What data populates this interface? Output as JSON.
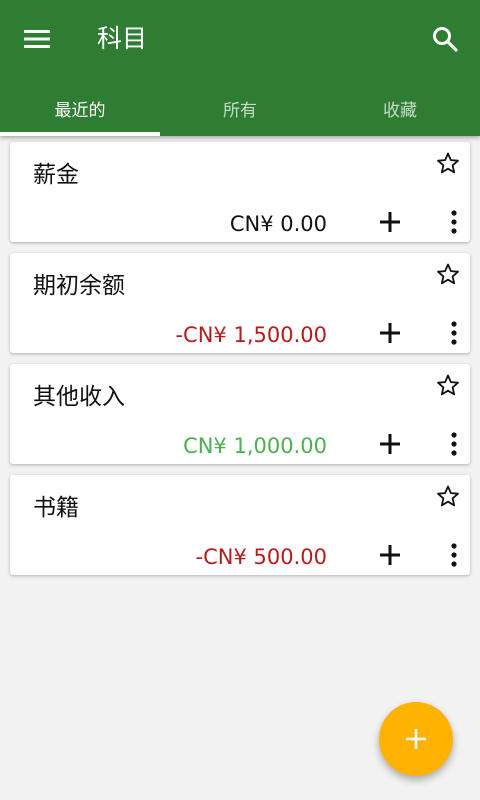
{
  "colors": {
    "primary": "#2e7d32",
    "accent": "#ffb300",
    "negative": "#b71c1c",
    "positive": "#4caf50",
    "neutral": "#111111"
  },
  "appbar": {
    "title": "科目",
    "menu_icon": "hamburger-menu-icon",
    "search_icon": "search-icon"
  },
  "tabs": [
    {
      "label": "最近的",
      "active": true
    },
    {
      "label": "所有",
      "active": false
    },
    {
      "label": "收藏",
      "active": false
    }
  ],
  "accounts": [
    {
      "name": "薪金",
      "balance": "CN¥ 0.00",
      "balance_status": "neutral",
      "favorite": false
    },
    {
      "name": "期初余额",
      "balance": "-CN¥ 1,500.00",
      "balance_status": "negative",
      "favorite": false
    },
    {
      "name": "其他收入",
      "balance": "CN¥ 1,000.00",
      "balance_status": "positive",
      "favorite": false
    },
    {
      "name": "书籍",
      "balance": "-CN¥ 500.00",
      "balance_status": "negative",
      "favorite": false
    }
  ],
  "fab": {
    "icon": "plus-icon"
  }
}
